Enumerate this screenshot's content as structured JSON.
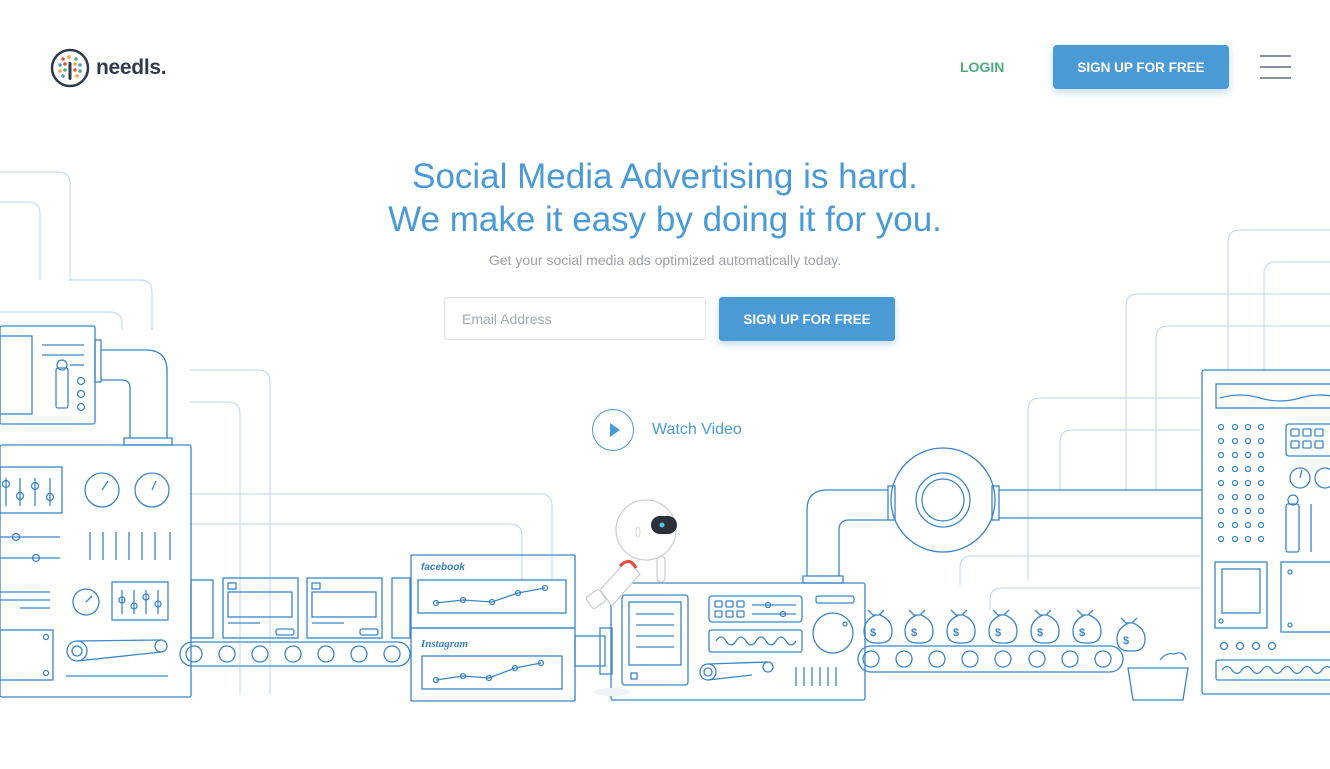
{
  "brand": {
    "name": "needls."
  },
  "nav": {
    "login_label": "LOGIN",
    "signup_label": "SIGN UP FOR FREE"
  },
  "hero": {
    "headline_line1": "Social Media Advertising is hard.",
    "headline_line2": "We make it easy by doing it for you.",
    "subheadline": "Get your social media ads optimized automatically today.",
    "email_placeholder": "Email Address",
    "signup_label": "SIGN UP FOR FREE",
    "watch_video_label": "Watch Video"
  },
  "illustration": {
    "facebook_label": "facebook",
    "instagram_label": "Instagram",
    "money_symbol": "$"
  },
  "colors": {
    "accent": "#4a9ad6",
    "login_green": "#4fae7e",
    "text_dark": "#2f3b4c",
    "line_blue": "#3a86c8",
    "pipe_light": "#c5dcef"
  },
  "icons": {
    "menu": "hamburger-icon",
    "play": "play-icon"
  }
}
